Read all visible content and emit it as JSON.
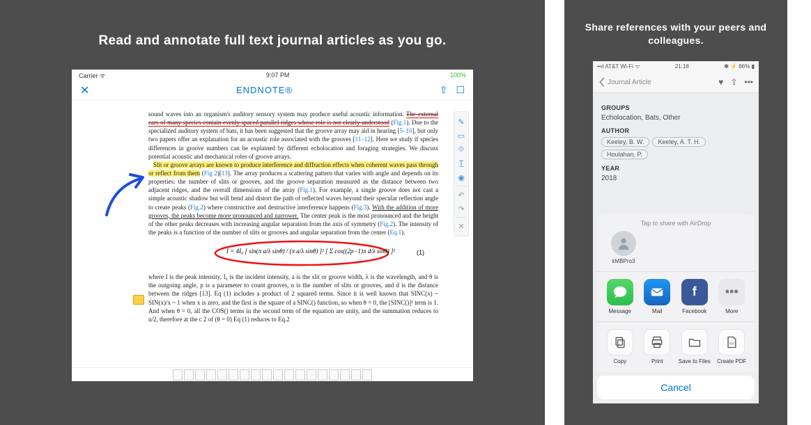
{
  "left": {
    "caption": "Read and annotate full text journal articles as you go.",
    "status": {
      "carrier": "Carrier  ᯤ",
      "time": "9:07 PM",
      "battery": "100%"
    },
    "nav": {
      "close": "✕",
      "title": "ENDNOTE®",
      "share": "⇧",
      "open": "☐"
    },
    "paragraph1_a": "sound waves into an organism's auditory sensory system may produce useful acoustic information. ",
    "paragraph1_strike": "The external ears of many species contain evenly spaced parallel ridges whose role is not clearly understood",
    "paragraph1_b": " (",
    "fig1": "Fig.1",
    "paragraph1_c": "). Due to the specialized auditory system of bats, it has been suggested that the groove array may aid in hearing [",
    "refs58": "5–10",
    "paragraph1_d": "], but only two papers offer an explanation for an acoustic role associated with the grooves [",
    "refs1112": "11–12",
    "paragraph1_e": "]. Here we study if species differences in groove numbers can be explained by different echolocation and foraging strategies. We discuss potential acoustic and mechanical roles of groove arrays.",
    "hl1": "Slit or groove arrays are known to produce interference and diffraction effects when coherent waves pass through or reflect from them",
    "paragraph2_a": " (",
    "fig2": "Fig 2",
    "paragraph2_b": ")[",
    "ref13": "13",
    "paragraph2_c": "]. The array produces a scattering pattern that varies with angle and depends on its properties: the number of slits or grooves, and the groove separation measured as the distance between two adjacent ridges, and the overall dimensions of the array (",
    "fig1b": "Fig.1",
    "paragraph2_d": "). For example, a single groove does not cast a simple acoustic shadow but will bend and distort the path of reflected waves beyond their specular reflection angle to create peaks (",
    "fig2b": "Fig.2",
    "paragraph2_e": ") where constructive and destructive interference happens (",
    "fig3": "Fig.3",
    "paragraph2_f": "). ",
    "underline2": "With the addition of more grooves, the peaks become more pronounced and narrower.",
    "paragraph2_g": " The center peak is the most pronounced and the height of the other peaks decreases with increasing angular separation from the axis of symmetry (",
    "fig2c": "Fig.2",
    "paragraph2_h": "). The intensity of the peaks is a function of the number of slits or grooves and angular separation from the center (",
    "eq1ref": "Eq.1",
    "paragraph2_i": ").",
    "equation": "I = 4I₀ [ sin(π a/λ sinθ) / (π a/λ sinθ) ]² [ Σ cos((2p−1)π d/λ sinθ) ]²",
    "eqnum": "(1)",
    "paragraph3": "where I is the peak intensity, I₀ is the incident intensity, a is the slit or groove width, λ is the wavelength, and θ is the outgoing angle, p is a parameter to count grooves, n is the number of slits or grooves, and d is the distance between the ridges [13]. Eq (1) includes a product of 2 squared terms. Since it is well known that SINC(x) ~ SIN(x)/x ~ 1 when x is zero, and the first is the square of a SINC() function, so when θ = 0, the [SINC()]² term is 1. And when θ = 0, all the COS() terms in the second term of the equation are unity, and the summation reduces to n/2, therefore at the c    2 of    (θ = 0) Eq (1) reduces to Eq.2",
    "tools": [
      "pen-icon",
      "comment-icon",
      "lasso-icon",
      "text-tool-icon",
      "stamp-icon",
      "undo-icon",
      "redo-icon",
      "close-tools-icon"
    ]
  },
  "right": {
    "caption": "Share references with your peers and colleagues.",
    "status": {
      "carrier": "••ıl AT&T Wi-Fi  ᯤ",
      "time": "21:18",
      "battery": "✽ ⚡ 86% ▮"
    },
    "nav": {
      "back": "Journal Article",
      "heart": "♥",
      "share": "⇧",
      "more": "•••"
    },
    "groups_label": "GROUPS",
    "groups_value": "Echolocation, Bats, Other",
    "author_label": "AUTHOR",
    "authors": [
      "Keeley, B. W.",
      "Keeley, A. T. H.",
      "Houlahan, P."
    ],
    "year_label": "YEAR",
    "year_value": "2018",
    "airdrop_hint": "Tap to share with AirDrop",
    "airdrop_contact": "kMBPro3",
    "apps": [
      {
        "name": "Message",
        "icon": "msg",
        "glyph": "✉"
      },
      {
        "name": "Mail",
        "icon": "mail",
        "glyph": "✉"
      },
      {
        "name": "Facebook",
        "icon": "fb",
        "glyph": "f"
      },
      {
        "name": "More",
        "icon": "more",
        "glyph": "•••"
      }
    ],
    "actions": [
      {
        "name": "Copy",
        "icon": "copy"
      },
      {
        "name": "Print",
        "icon": "print"
      },
      {
        "name": "Save to Files",
        "icon": "folder"
      },
      {
        "name": "Create PDF",
        "icon": "pdf"
      }
    ],
    "cancel": "Cancel"
  }
}
